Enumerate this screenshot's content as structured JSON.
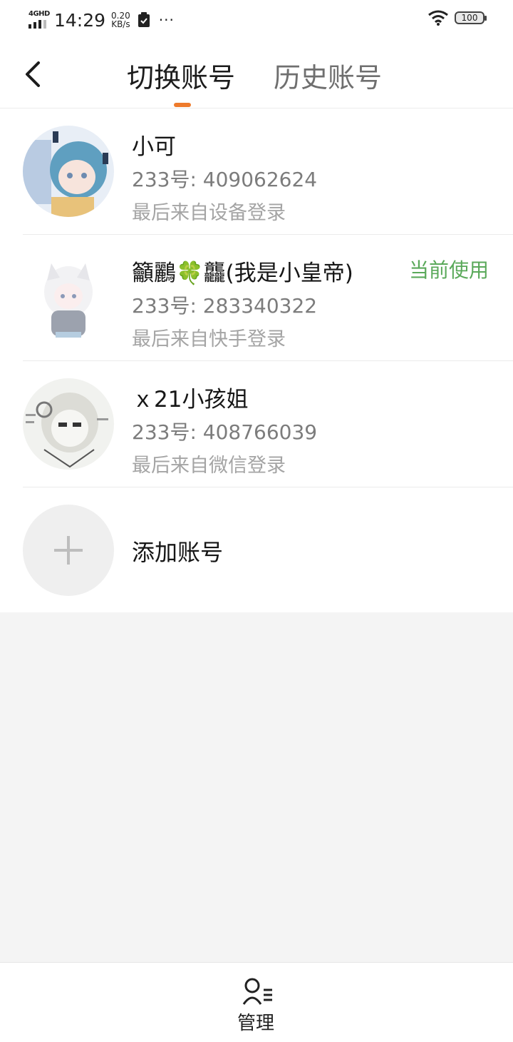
{
  "status_bar": {
    "network": "4GHD",
    "time": "14:29",
    "speed_value": "0.20",
    "speed_unit": "KB/s",
    "more": "···",
    "battery": "100"
  },
  "nav": {
    "tabs": [
      {
        "label": "切换账号",
        "active": true
      },
      {
        "label": "历史账号",
        "active": false
      }
    ],
    "accent_color": "#ee7a2b"
  },
  "accounts": [
    {
      "name": "小可",
      "id_text": "233号: 409062624",
      "login_text": "最后来自设备登录",
      "current": ""
    },
    {
      "name": "籲鸝🍀龘(我是小皇帝)",
      "id_text": "233号: 283340322",
      "login_text": "最后来自快手登录",
      "current": "当前使用"
    },
    {
      "name": "ｘ21小孩姐",
      "id_text": "233号: 408766039",
      "login_text": "最后来自微信登录",
      "current": ""
    }
  ],
  "add_account": {
    "label": "添加账号"
  },
  "bottom": {
    "manage_label": "管理"
  },
  "colors": {
    "current_badge": "#5aa95a",
    "background": "#f4f4f4"
  }
}
